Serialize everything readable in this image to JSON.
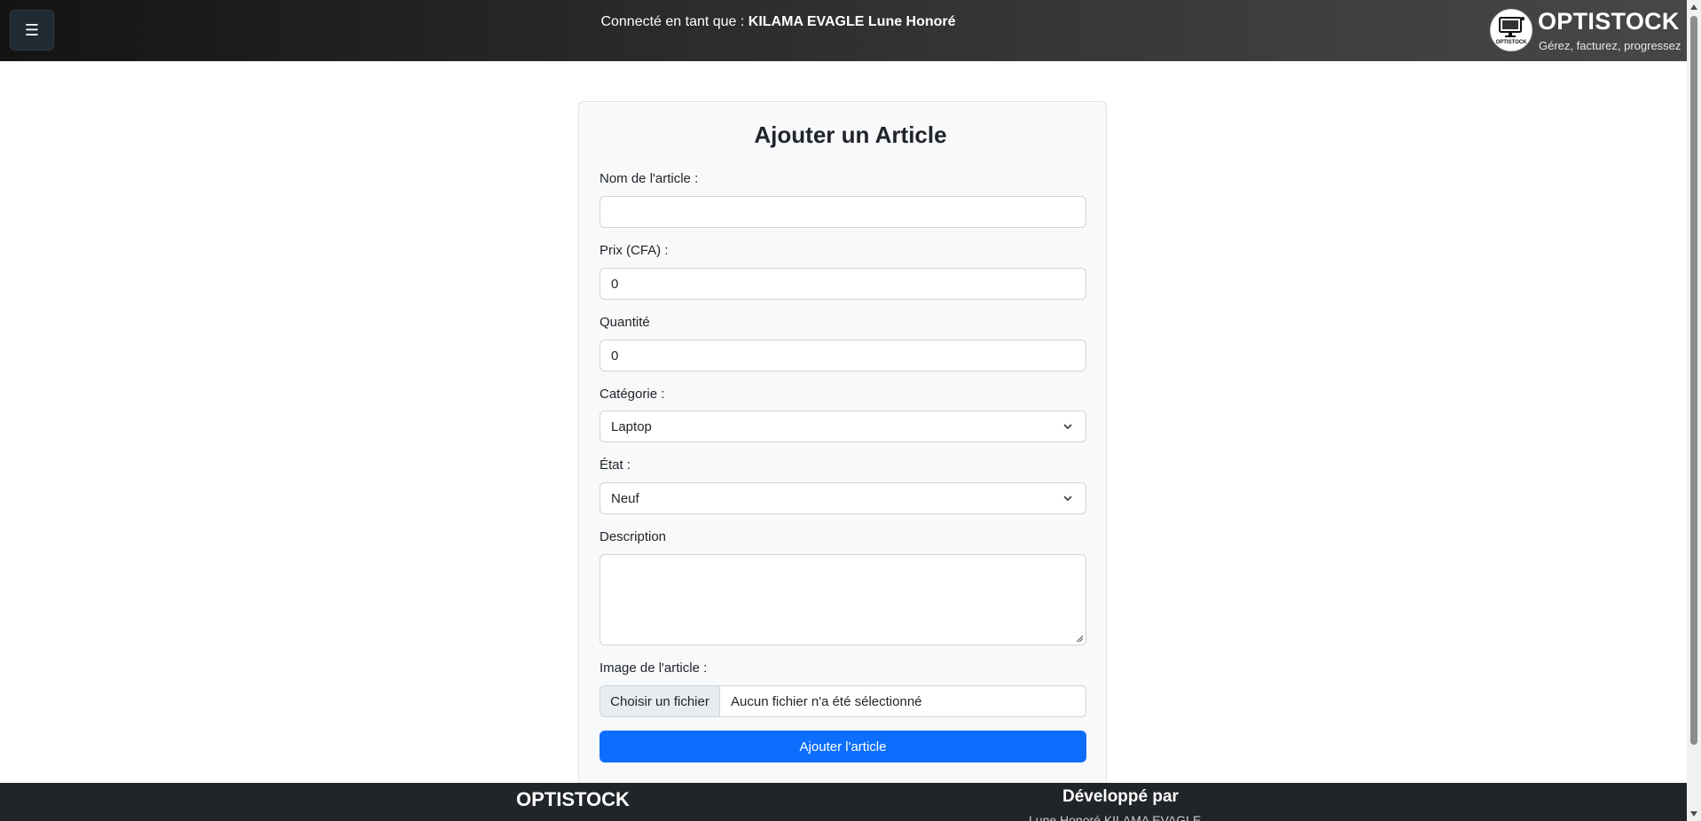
{
  "header": {
    "menu_icon": "hamburger-icon",
    "connected_prefix": "Connecté en tant que : ",
    "user_name": "KILAMA EVAGLE Lune Honoré",
    "brand_name": "OPTISTOCK",
    "brand_tagline": "Gérez, facturez, progressez",
    "logo_text": "OPTISTOCK"
  },
  "form": {
    "title": "Ajouter un Article",
    "name_label": "Nom de l'article :",
    "name_value": "",
    "price_label": "Prix (CFA) :",
    "price_value": "0",
    "quantity_label": "Quantité",
    "quantity_value": "0",
    "category_label": "Catégorie :",
    "category_selected": "Laptop",
    "state_label": "État :",
    "state_selected": "Neuf",
    "description_label": "Description",
    "description_value": "",
    "image_label": "Image de l'article :",
    "file_button": "Choisir un fichier",
    "file_status": "Aucun fichier n'a été sélectionné",
    "submit_label": "Ajouter l'article"
  },
  "footer": {
    "brand": "OPTISTOCK",
    "developed_by": "Développé par",
    "developer_name": "Lune Honoré KILAMA EVAGLE"
  },
  "colors": {
    "primary": "#0d6efd",
    "footer_bg": "#212529",
    "card_bg": "#f8f9fa"
  }
}
